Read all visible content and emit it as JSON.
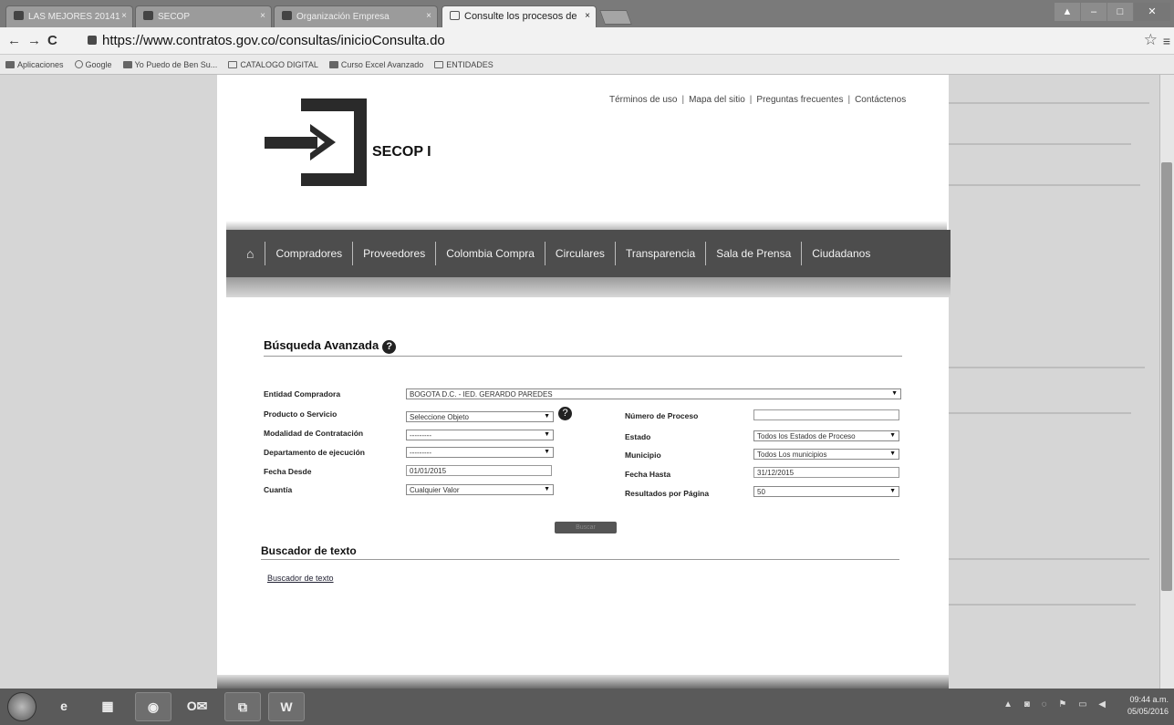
{
  "browser": {
    "tabs": [
      {
        "label": "LAS MEJORES 20141",
        "active": false
      },
      {
        "label": "SECOP",
        "active": false
      },
      {
        "label": "Organización Empresa",
        "active": false
      },
      {
        "label": "Consulte los procesos de",
        "active": true
      }
    ],
    "url": "https://www.contratos.gov.co/consultas/inicioConsulta.do",
    "bookmarks": [
      {
        "label": "Aplicaciones",
        "icon": "apps-icon"
      },
      {
        "label": "Google",
        "icon": "google-icon"
      },
      {
        "label": "Yo Puedo de Ben Su...",
        "icon": "video-icon"
      },
      {
        "label": "CATALOGO DIGITAL",
        "icon": "page-icon"
      },
      {
        "label": "Curso Excel Avanzado",
        "icon": "video-icon"
      },
      {
        "label": "ENTIDADES",
        "icon": "folder-icon"
      }
    ]
  },
  "site": {
    "top_links": [
      "Términos de uso",
      "Mapa del sitio",
      "Preguntas frecuentes",
      "Contáctenos"
    ],
    "logo_text": "SECOP I",
    "nav": [
      "Compradores",
      "Proveedores",
      "Colombia Compra",
      "Circulares",
      "Transparencia",
      "Sala de Prensa",
      "Ciudadanos"
    ]
  },
  "search": {
    "title": "Búsqueda Avanzada",
    "fields": {
      "entidad": {
        "label": "Entidad Compradora",
        "value": "BOGOTA D.C. - IED. GERARDO PAREDES"
      },
      "producto": {
        "label": "Producto o Servicio",
        "value": "Seleccione Objeto"
      },
      "numero": {
        "label": "Número de Proceso",
        "value": ""
      },
      "modalidad": {
        "label": "Modalidad de Contratación",
        "value": "---------"
      },
      "estado": {
        "label": "Estado",
        "value": "Todos los Estados de Proceso"
      },
      "departamento": {
        "label": "Departamento de ejecución",
        "value": "---------"
      },
      "municipio": {
        "label": "Municipio",
        "value": "Todos Los municipios"
      },
      "fecha_desde": {
        "label": "Fecha Desde",
        "value": "01/01/2015"
      },
      "fecha_hasta": {
        "label": "Fecha Hasta",
        "value": "31/12/2015"
      },
      "cuantia": {
        "label": "Cuantía",
        "value": "Cualquier Valor"
      },
      "resultados": {
        "label": "Resultados por Página",
        "value": "50"
      }
    },
    "button_label": "Buscar"
  },
  "text_search": {
    "title": "Buscador de texto",
    "link": "Buscador de texto"
  },
  "taskbar": {
    "time": "09:44 a.m.",
    "date": "05/05/2016"
  },
  "colors": {
    "nav_bg": "#4d4d4d",
    "page_bg": "#ffffff",
    "chrome_bg": "#f2f2f2"
  }
}
